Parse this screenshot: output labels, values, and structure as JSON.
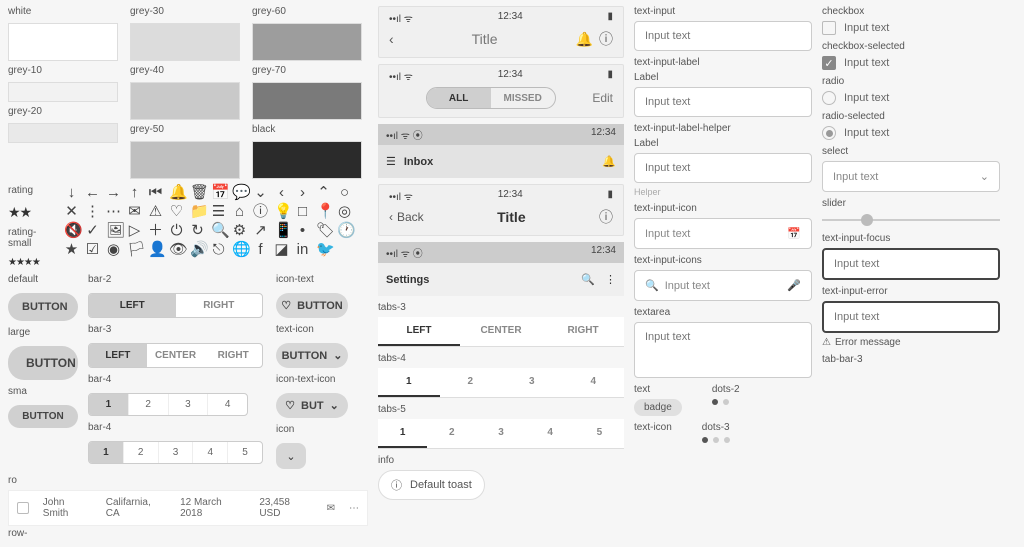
{
  "swatches": {
    "white": "white",
    "grey10": "grey-10",
    "grey20": "grey-20",
    "grey30": "grey-30",
    "grey40": "grey-40",
    "grey50": "grey-50",
    "grey60": "grey-60",
    "grey70": "grey-70",
    "black": "black"
  },
  "rating_label": "rating",
  "rating_small_label": "rating-small",
  "buttons": {
    "default_label": "default",
    "default": "BUTTON",
    "large_label": "large",
    "large": "BUTTON",
    "small_label": "sma",
    "small": "BUTTON",
    "bar2_label": "bar-2",
    "bar3_label": "bar-3",
    "bar4_label": "bar-4",
    "bar4b_label": "bar-4",
    "left": "LEFT",
    "center": "CENTER",
    "right": "RIGHT",
    "n1": "1",
    "n2": "2",
    "n3": "3",
    "n4": "4",
    "n5": "5",
    "icon_text_label": "icon-text",
    "icon_text": "BUTTON",
    "text_icon_label": "text-icon",
    "text_icon": "BUTTON",
    "icon_text_icon_label": "icon-text-icon",
    "icon_text_icon": "BUT",
    "icon_label": "icon"
  },
  "row_label": "ro",
  "row": "row-",
  "row_name": "John Smith",
  "row_loc": "Califarnia, CA",
  "row_date": "12 March 2018",
  "row_amt": "23,458 USD",
  "phone": {
    "time": "12:34",
    "title": "Title",
    "all": "ALL",
    "missed": "MISSED",
    "edit": "Edit",
    "inbox": "Inbox",
    "back": "Back",
    "settings": "Settings",
    "tabs3_label": "tabs-3",
    "tabs4_label": "tabs-4",
    "tabs5_label": "tabs-5",
    "left": "LEFT",
    "center": "CENTER",
    "right": "RIGHT",
    "n1": "1",
    "n2": "2",
    "n3": "3",
    "n4": "4",
    "n5": "5",
    "info_label": "info",
    "toast": "Default toast"
  },
  "inputs": {
    "text_input_label": "text-input",
    "placeholder": "Input text",
    "til_label": "text-input-label",
    "til_sub": "Label",
    "tilh_label": "text-input-label-helper",
    "tilh_sub": "Label",
    "tilh_helper": "Helper",
    "tii_label": "text-input-icon",
    "tiis_label": "text-input-icons",
    "ta_label": "textarea",
    "text_label": "text",
    "badge": "badge",
    "dots2_label": "dots-2",
    "ticon_label": "text-icon",
    "dots3_label": "dots-3"
  },
  "controls": {
    "checkbox_label": "checkbox",
    "checkbox_text": "Input text",
    "checkbox_sel_label": "checkbox-selected",
    "radio_label": "radio",
    "radio_sel_label": "radio-selected",
    "select_label": "select",
    "select_text": "Input text",
    "slider_label": "slider",
    "focus_label": "text-input-focus",
    "error_label": "text-input-error",
    "error_msg": "Error message",
    "tab_bar_label": "tab-bar-3"
  }
}
